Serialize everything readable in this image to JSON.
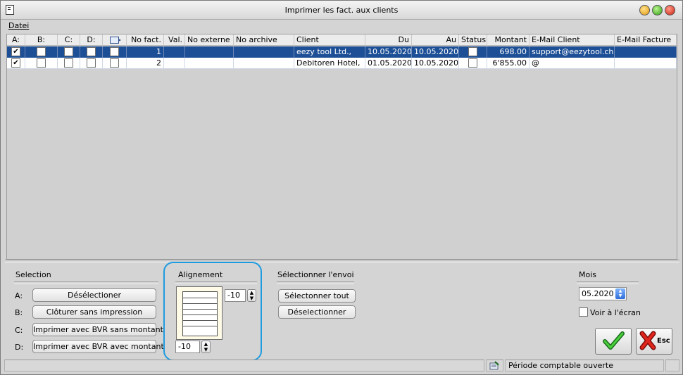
{
  "window": {
    "title": "Imprimer les fact. aux clients"
  },
  "menu": {
    "items": [
      "Datei"
    ]
  },
  "table": {
    "columns": [
      "A:",
      "B:",
      "C:",
      "D:",
      "",
      "No fact.",
      "Val.",
      "No externe",
      "No archive",
      "Client",
      "Du",
      "Au",
      "Status",
      "Montant",
      "E-Mail Client",
      "E-Mail Facture"
    ],
    "rows": [
      {
        "a": "✔",
        "b": "",
        "c": "",
        "d": "",
        "e": "",
        "no_fact": "1",
        "val": "",
        "no_externe": "",
        "no_archive": "",
        "client": "eezy tool Ltd.,",
        "du": "10.05.2020",
        "au": "10.05.2020",
        "status": "",
        "montant": "698.00",
        "email_client": "support@eezytool.ch",
        "email_facture": ""
      },
      {
        "a": "✔",
        "b": "",
        "c": "",
        "d": "",
        "e": "",
        "no_fact": "2",
        "val": "",
        "no_externe": "",
        "no_archive": "",
        "client": "Debitoren Hotel,",
        "du": "01.05.2020",
        "au": "10.05.2020",
        "status": "",
        "montant": "6'855.00",
        "email_client": "@",
        "email_facture": ""
      }
    ]
  },
  "selection": {
    "title": "Selection",
    "rows": [
      {
        "key": "A:",
        "button": "Désélectioner"
      },
      {
        "key": "B:",
        "button": "Clôturer sans impression"
      },
      {
        "key": "C:",
        "button": "Imprimer avec BVR sans montant"
      },
      {
        "key": "D:",
        "button": "Imprimer avec BVR avec montant"
      }
    ]
  },
  "alignment": {
    "title": "Alignement",
    "horizontal": "-10",
    "vertical": "-10"
  },
  "envoi": {
    "title": "Sélectionner l'envoi",
    "select_all": "Sélectonner tout",
    "deselect": "Déselectionner"
  },
  "mois": {
    "title": "Mois",
    "value": "05.2020",
    "screen_label": "Voir à l'écran"
  },
  "actions": {
    "esc_label": "Esc"
  },
  "status_bar": {
    "text": "Période comptable ouverte"
  }
}
